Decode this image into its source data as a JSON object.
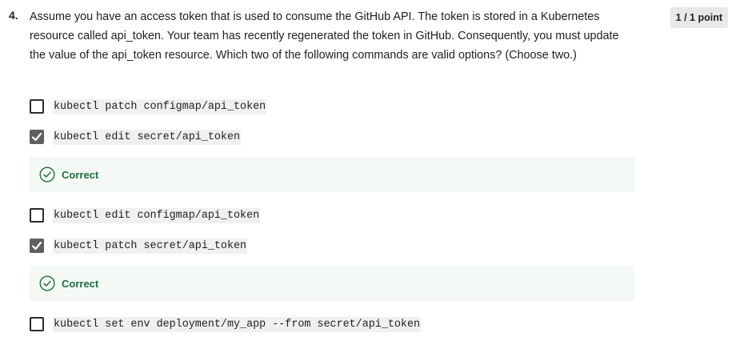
{
  "question": {
    "number": "4.",
    "text": "Assume you have an access token that is used to consume the GitHub API. The token is stored in a Kubernetes resource called api_token. Your team has recently regenerated the token in GitHub. Consequently, you must update the value of the api_token resource. Which two of the following commands are valid options? (Choose two.)",
    "points": "1 / 1 point"
  },
  "options": [
    {
      "code": "kubectl patch configmap/api_token",
      "checked": false
    },
    {
      "code": "kubectl edit secret/api_token",
      "checked": true,
      "feedback": "Correct"
    },
    {
      "code": "kubectl edit configmap/api_token",
      "checked": false
    },
    {
      "code": "kubectl patch secret/api_token",
      "checked": true,
      "feedback": "Correct"
    },
    {
      "code": "kubectl set env deployment/my_app --from secret/api_token",
      "checked": false
    }
  ],
  "colors": {
    "feedback_bg": "#f4f9f6",
    "feedback_text": "#1f6d3f",
    "checked_box": "#5f5f5f"
  },
  "icons": {
    "checkbox_check": "check-icon",
    "feedback": "check-circle-icon"
  }
}
